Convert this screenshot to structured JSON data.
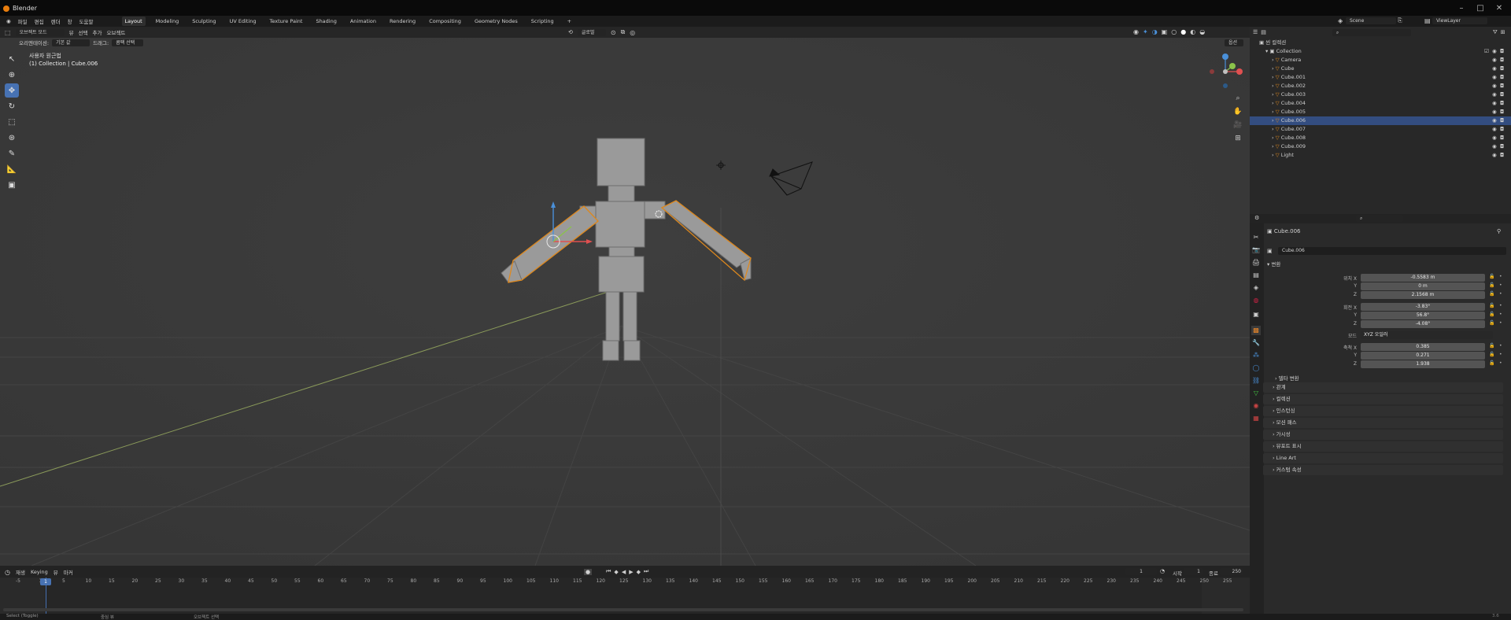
{
  "app": {
    "title": "Blender"
  },
  "menu": [
    "파일",
    "편집",
    "렌더",
    "창",
    "도움말"
  ],
  "workspaces": [
    {
      "label": "Layout",
      "active": true
    },
    {
      "label": "Modeling"
    },
    {
      "label": "Sculpting"
    },
    {
      "label": "UV Editing"
    },
    {
      "label": "Texture Paint"
    },
    {
      "label": "Shading"
    },
    {
      "label": "Animation"
    },
    {
      "label": "Rendering"
    },
    {
      "label": "Compositing"
    },
    {
      "label": "Geometry Nodes"
    },
    {
      "label": "Scripting"
    }
  ],
  "scene": {
    "name": "Scene",
    "view_layer": "ViewLayer"
  },
  "viewport_header": {
    "mode": "오브젝트 모드",
    "menus": [
      "뷰",
      "선택",
      "추가",
      "오브젝트"
    ],
    "orientation_label": "오리엔테이션:",
    "orientation": "기본 값",
    "drag_label": "드래그:",
    "drag": "콤팩 선택",
    "pivot": "글로벌",
    "options": "옵션"
  },
  "viewport": {
    "view_name": "사용자 원근법",
    "context": "(1) Collection | Cube.006"
  },
  "outliner": {
    "root": "씬 컬렉션",
    "collection": "Collection",
    "items": [
      {
        "name": "Camera",
        "color": "#e0891d",
        "sel": false
      },
      {
        "name": "Cube",
        "color": "#e0891d",
        "sel": false
      },
      {
        "name": "Cube.001",
        "color": "#e0891d",
        "sel": false
      },
      {
        "name": "Cube.002",
        "color": "#e0891d",
        "sel": false
      },
      {
        "name": "Cube.003",
        "color": "#e0891d",
        "sel": false
      },
      {
        "name": "Cube.004",
        "color": "#e0891d",
        "sel": false
      },
      {
        "name": "Cube.005",
        "color": "#e0891d",
        "sel": false
      },
      {
        "name": "Cube.006",
        "color": "#e0891d",
        "sel": true
      },
      {
        "name": "Cube.007",
        "color": "#e0891d",
        "sel": false
      },
      {
        "name": "Cube.008",
        "color": "#e0891d",
        "sel": false
      },
      {
        "name": "Cube.009",
        "color": "#e0891d",
        "sel": false
      },
      {
        "name": "Light",
        "color": "#e0891d",
        "sel": false
      }
    ]
  },
  "properties": {
    "object_header": "Cube.006",
    "object_name": "Cube.006",
    "transform_label": "변환",
    "location": {
      "label": "위치 X",
      "x": "-0.5583 m",
      "y": "0 m",
      "z": "2.1568 m"
    },
    "rotation": {
      "label": "회전 X",
      "x": "-3.83°",
      "y": "56.8°",
      "z": "-4.08°"
    },
    "mode": {
      "label": "모드",
      "value": "XYZ 오일러"
    },
    "scale": {
      "label": "축척 X",
      "x": "0.385",
      "y": "0.271",
      "z": "1.938"
    },
    "delta_label": "델타 변환",
    "panels": [
      "관계",
      "컬렉션",
      "인스턴싱",
      "모션 패스",
      "가시성",
      "뷰포트 표시",
      "Line Art",
      "커스텀 속성"
    ]
  },
  "timeline": {
    "menus": [
      "재생",
      "Keying",
      "뷰",
      "마커"
    ],
    "current_frame": "1",
    "start_label": "시작",
    "start": "1",
    "end_label": "종료",
    "end": "250",
    "ruler": [
      "-5",
      "1",
      "5",
      "10",
      "15",
      "20",
      "25",
      "30",
      "35",
      "40",
      "45",
      "50",
      "55",
      "60",
      "65",
      "70",
      "75",
      "80",
      "85",
      "90",
      "95",
      "100",
      "105",
      "110",
      "115",
      "120",
      "125",
      "130",
      "135",
      "140",
      "145",
      "150",
      "155",
      "160",
      "165",
      "170",
      "175",
      "180",
      "185",
      "190",
      "195",
      "200",
      "205",
      "210",
      "215",
      "220",
      "225",
      "230",
      "235",
      "240",
      "245",
      "250",
      "255"
    ]
  },
  "status": {
    "left": "Select (Toggle)",
    "mid": "중심 뷰",
    "right": "오브젝트 선택",
    "version": "3.6"
  },
  "colors": {
    "accent": "#4772b3",
    "selection": "#e0891d",
    "x_axis": "#e05050",
    "y_axis": "#8bc34a",
    "z_axis": "#4a90d9"
  }
}
